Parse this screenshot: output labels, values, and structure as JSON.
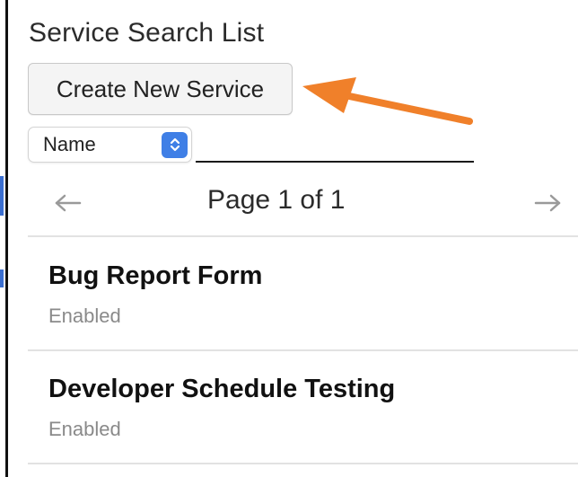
{
  "header": {
    "title": "Service Search List"
  },
  "toolbar": {
    "create_label": "Create New Service"
  },
  "filter": {
    "selected_field": "Name",
    "search_value": ""
  },
  "pager": {
    "label": "Page 1 of 1",
    "prev_icon": "arrow-left-icon",
    "next_icon": "arrow-right-icon"
  },
  "services": [
    {
      "name": "Bug Report Form",
      "status": "Enabled"
    },
    {
      "name": "Developer Schedule Testing",
      "status": "Enabled"
    }
  ],
  "annotation": {
    "icon": "orange-pointer-arrow",
    "color": "#f0802a"
  },
  "colors": {
    "accent": "#3f7fe6",
    "muted_text": "#8a8a8a",
    "divider": "#e2e2e2"
  }
}
